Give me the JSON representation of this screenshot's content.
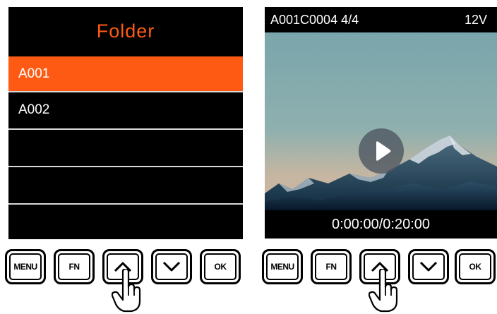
{
  "colors": {
    "accent": "#ff5a14",
    "selected_row": "#ff5a14",
    "screen_bg": "#000000",
    "text": "#ffffff"
  },
  "folder_screen": {
    "title": "Folder",
    "items": [
      {
        "label": "A001",
        "selected": true
      },
      {
        "label": "A002",
        "selected": false
      },
      {
        "label": "",
        "selected": false
      },
      {
        "label": "",
        "selected": false
      },
      {
        "label": "",
        "selected": false
      }
    ]
  },
  "playback_screen": {
    "clip_name": "A001C0004 4/4",
    "voltage": "12V",
    "timecode": "0:00:00/0:20:00",
    "play_icon": "play-icon"
  },
  "left_buttons": [
    {
      "label": "MENU"
    },
    {
      "label": "FN"
    },
    {
      "label": "",
      "icon": "chevron-up-icon",
      "pressed": true
    },
    {
      "label": "",
      "icon": "chevron-down-icon"
    },
    {
      "label": "OK"
    }
  ],
  "right_buttons": [
    {
      "label": "MENU"
    },
    {
      "label": "FN"
    },
    {
      "label": "",
      "icon": "chevron-up-icon",
      "pressed": true
    },
    {
      "label": "",
      "icon": "chevron-down-icon"
    },
    {
      "label": "OK"
    }
  ],
  "pointer_icon": "hand-pointer-icon"
}
